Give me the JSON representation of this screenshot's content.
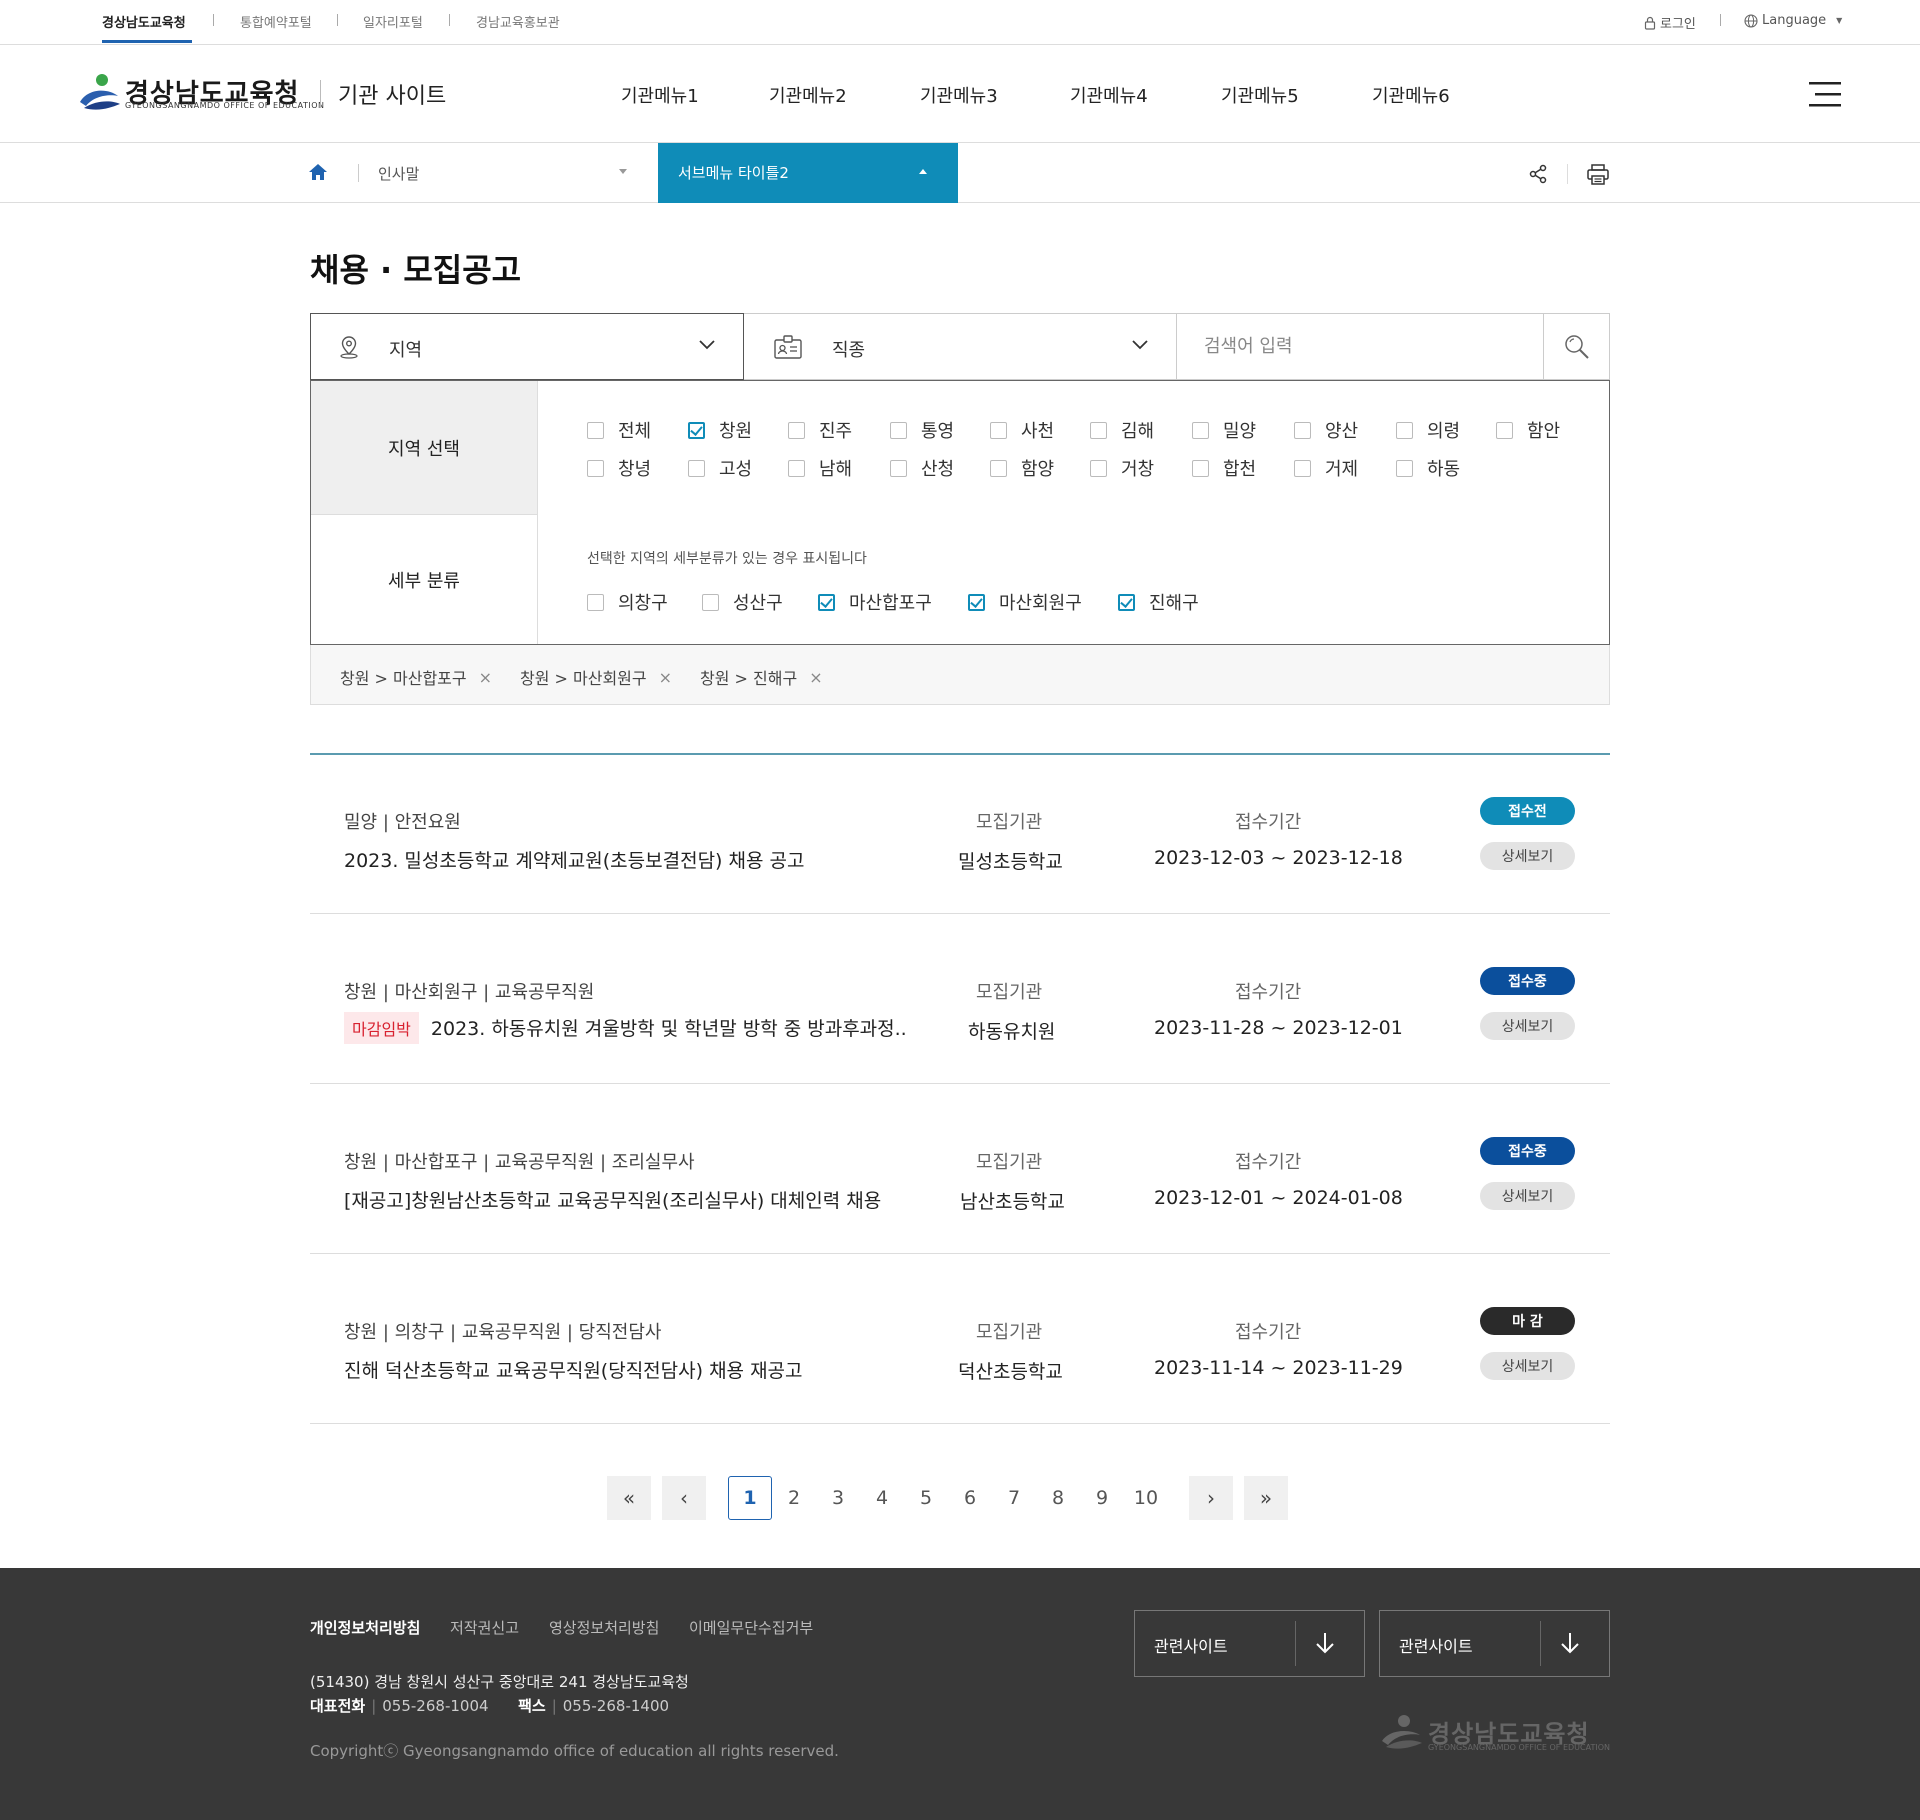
{
  "util_links": [
    "경상남도교육청",
    "통합예약포털",
    "일자리포털",
    "경남교육홍보관"
  ],
  "util_right": {
    "login": "로그인",
    "language": "Language"
  },
  "logo": {
    "name": "경상남도교육청",
    "sub": "GYEONGSANGNAMDO OFFICE OF EDUCATION"
  },
  "site_name": "기관 사이트",
  "gnb": [
    "기관메뉴1",
    "기관메뉴2",
    "기관메뉴3",
    "기관메뉴4",
    "기관메뉴5",
    "기관메뉴6"
  ],
  "location": {
    "menu1": "인사말",
    "menu2": "서브메뉴 타이틀2"
  },
  "page_title": "채용 · 모집공고",
  "search": {
    "region_label": "지역",
    "job_label": "직종",
    "placeholder": "검색어 입력"
  },
  "filter": {
    "region_head": "지역 선택",
    "detail_head": "세부 분류",
    "regions": [
      {
        "label": "전체",
        "checked": false
      },
      {
        "label": "창원",
        "checked": true
      },
      {
        "label": "진주",
        "checked": false
      },
      {
        "label": "통영",
        "checked": false
      },
      {
        "label": "사천",
        "checked": false
      },
      {
        "label": "김해",
        "checked": false
      },
      {
        "label": "밀양",
        "checked": false
      },
      {
        "label": "양산",
        "checked": false
      },
      {
        "label": "의령",
        "checked": false
      },
      {
        "label": "함안",
        "checked": false
      },
      {
        "label": "창녕",
        "checked": false
      },
      {
        "label": "고성",
        "checked": false
      },
      {
        "label": "남해",
        "checked": false
      },
      {
        "label": "산청",
        "checked": false
      },
      {
        "label": "함양",
        "checked": false
      },
      {
        "label": "거창",
        "checked": false
      },
      {
        "label": "합천",
        "checked": false
      },
      {
        "label": "거제",
        "checked": false
      },
      {
        "label": "하동",
        "checked": false
      }
    ],
    "detail_hint": "선택한 지역의 세부분류가 있는 경우 표시됩니다",
    "details": [
      {
        "label": "의창구",
        "checked": false
      },
      {
        "label": "성산구",
        "checked": false
      },
      {
        "label": "마산합포구",
        "checked": true
      },
      {
        "label": "마산회원구",
        "checked": true
      },
      {
        "label": "진해구",
        "checked": true
      }
    ]
  },
  "chips": [
    "창원 > 마산합포구",
    "창원 > 마산회원구",
    "창원 > 진해구"
  ],
  "chip_remove": "×",
  "columns": {
    "org": "모집기관",
    "period": "접수기간"
  },
  "jobs": [
    {
      "meta": "밀양 | 안전요원",
      "tag": "",
      "title": "2023. 밀성초등학교 계약제교원(초등보결전담) 채용 공고",
      "org": "밀성초등학교",
      "period": "2023-12-03 ~ 2023-12-18",
      "status": "접수전",
      "status_color": "#0f8cb8",
      "detail": "상세보기"
    },
    {
      "meta": "창원 | 마산회원구 | 교육공무직원",
      "tag": "마감임박",
      "title": "2023. 하동유치원 겨울방학 및 학년말 방학 중 방과후과정..",
      "org": "하동유치원",
      "period": "2023-11-28 ~ 2023-12-01",
      "status": "접수중",
      "status_color": "#0b4f9c",
      "detail": "상세보기"
    },
    {
      "meta": "창원 | 마산합포구 | 교육공무직원 | 조리실무사",
      "tag": "",
      "title": "[재공고]창원남산초등학교 교육공무직원(조리실무사) 대체인력 채용",
      "org": "남산초등학교",
      "period": "2023-12-01 ~ 2024-01-08",
      "status": "접수중",
      "status_color": "#0b4f9c",
      "detail": "상세보기"
    },
    {
      "meta": "창원 | 의창구 | 교육공무직원 | 당직전담사",
      "tag": "",
      "title": "진해 덕산초등학교 교육공무직원(당직전담사) 채용 재공고",
      "org": "덕산초등학교",
      "period": "2023-11-14 ~ 2023-11-29",
      "status": "마 감",
      "status_color": "#2a2a2a",
      "detail": "상세보기"
    }
  ],
  "pagination": {
    "pages": [
      "1",
      "2",
      "3",
      "4",
      "5",
      "6",
      "7",
      "8",
      "9",
      "10"
    ],
    "current": "1",
    "first": "«",
    "prev": "‹",
    "next": "›",
    "last": "»"
  },
  "footer": {
    "links": [
      "개인정보처리방침",
      "저작권신고",
      "영상정보처리방침",
      "이메일무단수집거부"
    ],
    "address": "(51430) 경남 창원시 성산구 중앙대로 241 경상남도교육청",
    "phone_label": "대표전화",
    "phone": "055-268-1004",
    "fax_label": "팩스",
    "fax": "055-268-1400",
    "copyright": "Copyrightⓒ Gyeongsangnamdo office of education all rights reserved.",
    "related1": "관련사이트",
    "related2": "관련사이트",
    "logo": "경상남도교육청",
    "logo_sub": "GYEONGSANGNAMDO OFFICE OF EDUCATION"
  },
  "icons": [
    "lock-icon",
    "globe-icon",
    "hamburger-icon",
    "home-icon",
    "share-icon",
    "print-icon",
    "location-pin-icon",
    "id-card-icon",
    "chevron-down-icon",
    "search-icon",
    "arrow-down-icon"
  ]
}
